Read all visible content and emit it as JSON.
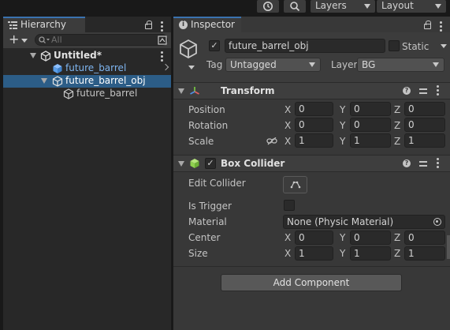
{
  "toolbar": {
    "history_icon": "history-icon",
    "search_icon": "search-icon",
    "layers_label": "Layers",
    "layout_label": "Layout"
  },
  "hierarchy": {
    "tab_label": "Hierarchy",
    "search_placeholder": "All",
    "scene": {
      "label": "Untitled*"
    },
    "items": [
      {
        "label": "future_barrel",
        "selected": false,
        "prefab": true
      },
      {
        "label": "future_barrel_obj",
        "selected": true,
        "prefab": false
      },
      {
        "label": "future_barrel",
        "selected": false,
        "prefab": false
      }
    ]
  },
  "inspector": {
    "tab_label": "Inspector",
    "object_name": "future_barrel_obj",
    "active": true,
    "static_label": "Static",
    "static": false,
    "tag_label": "Tag",
    "tag_value": "Untagged",
    "layer_label": "Layer",
    "layer_value": "BG",
    "transform": {
      "title": "Transform",
      "rows": [
        {
          "label": "Position",
          "x": "0",
          "y": "0",
          "z": "0"
        },
        {
          "label": "Rotation",
          "x": "0",
          "y": "0",
          "z": "0"
        },
        {
          "label": "Scale",
          "x": "1",
          "y": "1",
          "z": "1"
        }
      ]
    },
    "box_collider": {
      "title": "Box Collider",
      "enabled": true,
      "edit_collider_label": "Edit Collider",
      "is_trigger_label": "Is Trigger",
      "is_trigger": false,
      "material_label": "Material",
      "material_value": "None (Physic Material)",
      "center_label": "Center",
      "center": {
        "x": "0",
        "y": "0",
        "z": "0"
      },
      "size_label": "Size",
      "size": {
        "x": "1",
        "y": "1",
        "z": "1"
      }
    },
    "add_component_label": "Add Component",
    "axis_labels": {
      "x": "X",
      "y": "Y",
      "z": "Z"
    }
  },
  "colors": {
    "selection": "#2c5d87",
    "tab_accent": "#3a72b0",
    "prefab_text": "#7eb5f0",
    "collider_green": "#8fd14f"
  }
}
